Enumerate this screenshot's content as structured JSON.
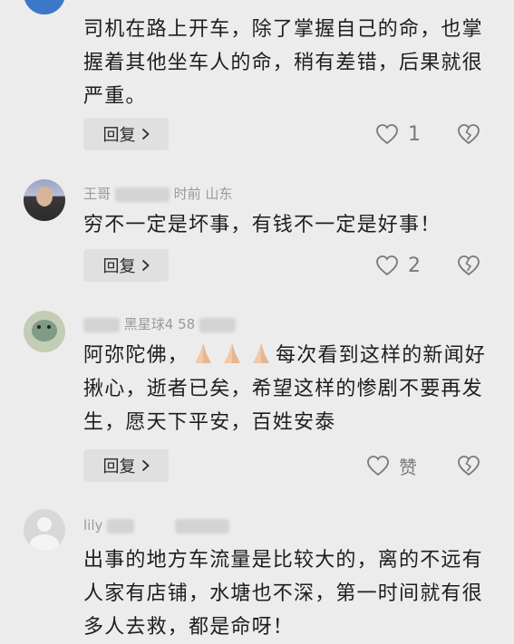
{
  "comments": [
    {
      "text": "司机在路上开车，除了掌握自己的命，也掌握着其他坐车人的命，稍有差错，后果就很严重。",
      "reply_label": "回复",
      "like_count": "1"
    },
    {
      "meta_partial": "王哥",
      "meta_partial2": "时前  山东",
      "text": "穷不一定是坏事，有钱不一定是好事！",
      "reply_label": "回复",
      "like_count": "2"
    },
    {
      "meta_partial": "黑星球4  58",
      "text_before": "阿弥陀佛，",
      "text_after": "每次看到这样的新闻好揪心，逝者已矣，希望这样的惨剧不要再发生，愿天下平安，百姓安泰",
      "emoji": [
        "folded-hands-emoji",
        "folded-hands-emoji",
        "folded-hands-emoji"
      ],
      "reply_label": "回复",
      "like_label": "赞"
    },
    {
      "meta_partial": "lily",
      "text": "出事的地方车流量是比较大的，离的不远有人家有店铺，水塘也不深，第一时间就有很多人去救，都是命呀！"
    }
  ],
  "colors": {
    "background": "#ececec",
    "reply_bg": "#e0e0e0",
    "meta_text": "#9a9a9a",
    "icon": "#7a7a7a"
  }
}
